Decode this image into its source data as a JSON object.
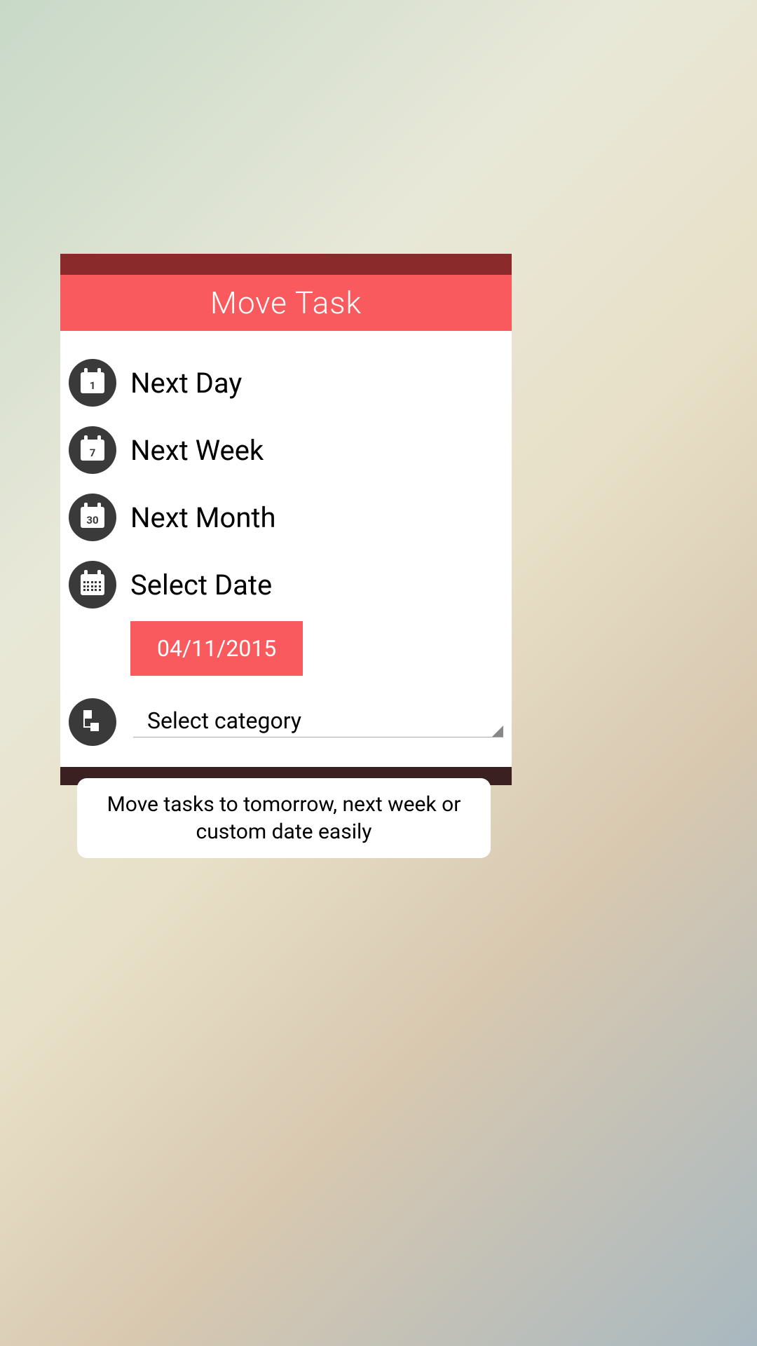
{
  "dialog": {
    "title": "Move Task",
    "options": {
      "next_day": {
        "label": "Next Day",
        "icon_value": "1"
      },
      "next_week": {
        "label": "Next Week",
        "icon_value": "7"
      },
      "next_month": {
        "label": "Next Month",
        "icon_value": "30"
      },
      "select_date": {
        "label": "Select Date"
      }
    },
    "selected_date": "04/11/2015",
    "category": {
      "placeholder": "Select category"
    }
  },
  "caption": {
    "text": "Move tasks to tomorrow, next week or custom date easily"
  },
  "colors": {
    "accent": "#f85a5e",
    "icon_bg": "#3a3a3a"
  }
}
